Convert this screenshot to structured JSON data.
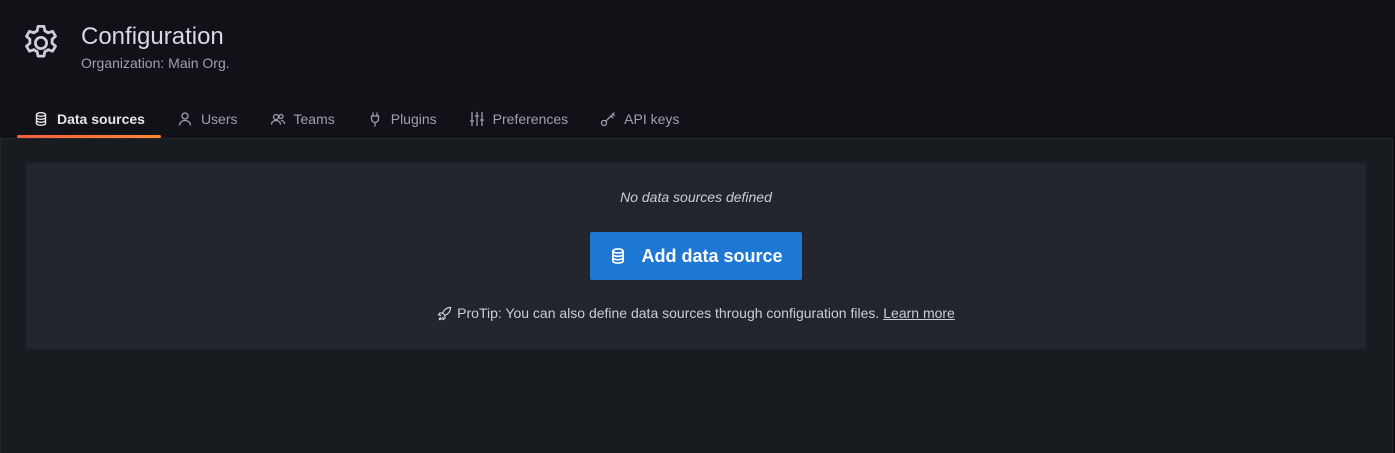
{
  "header": {
    "icon": "gear-icon",
    "title": "Configuration",
    "subtitle": "Organization: Main Org."
  },
  "tabs": [
    {
      "label": "Data sources",
      "icon": "database-icon",
      "active": true
    },
    {
      "label": "Users",
      "icon": "user-icon",
      "active": false
    },
    {
      "label": "Teams",
      "icon": "users-icon",
      "active": false
    },
    {
      "label": "Plugins",
      "icon": "plug-icon",
      "active": false
    },
    {
      "label": "Preferences",
      "icon": "sliders-icon",
      "active": false
    },
    {
      "label": "API keys",
      "icon": "key-icon",
      "active": false
    }
  ],
  "empty_state": {
    "title": "No data sources defined",
    "button_label": "Add data source",
    "button_icon": "database-icon",
    "protip_icon": "rocket-icon",
    "protip_text": "ProTip: You can also define data sources through configuration files.",
    "protip_link": "Learn more"
  },
  "colors": {
    "background": "#111217",
    "panel": "#22252b",
    "primary_button": "#1f77d4",
    "active_tab_underline": "#f55f3e"
  }
}
